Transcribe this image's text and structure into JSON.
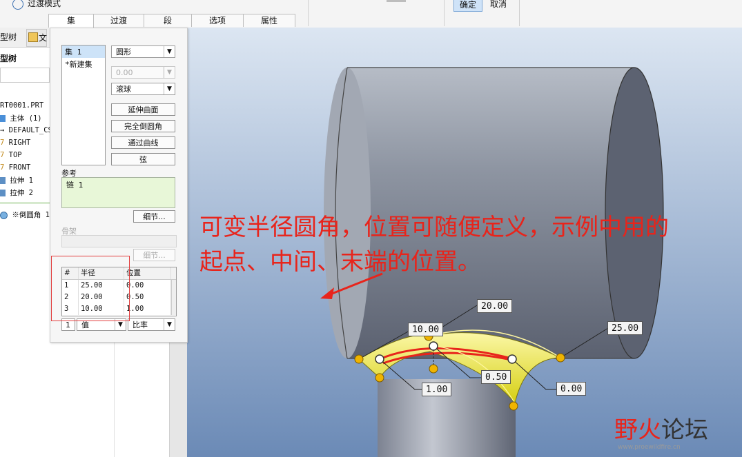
{
  "ribbon": {
    "transition_mode": "过渡模式",
    "tabs": [
      "集",
      "过渡",
      "段",
      "选项",
      "属性"
    ],
    "ok_label": "确定",
    "cancel_label": "取消"
  },
  "tree": {
    "tab_label": "型树",
    "tab2_label": "文",
    "title": "型树",
    "items": [
      "RT0001.PRT",
      "主体 (1)",
      "DEFAULT_CSY",
      "RIGHT",
      "TOP",
      "FRONT",
      "拉伸 1",
      "拉伸 2",
      "※倒圆角 1"
    ]
  },
  "dialog": {
    "set_list": [
      "集 1",
      "*新建集"
    ],
    "shape_value": "圆形",
    "disabled_value": "0.00",
    "method_value": "滚球",
    "buttons": [
      "延伸曲面",
      "完全倒圆角",
      "通过曲线",
      "弦"
    ],
    "ref_label": "参考",
    "ref_value": "链 1",
    "detail_label": "细节...",
    "skeleton_label": "骨架",
    "skeleton_detail_label": "细节...",
    "table": {
      "headers": [
        "#",
        "半径",
        "位置"
      ],
      "rows": [
        [
          "1",
          "25.00",
          "0.00"
        ],
        [
          "2",
          "20.00",
          "0.50"
        ],
        [
          "3",
          "10.00",
          "1.00"
        ]
      ]
    },
    "footer": {
      "index": "1",
      "type_value": "值",
      "ratio_value": "比率"
    }
  },
  "viewport": {
    "annotation_line1": "可变半径圆角，位置可随便定义，示例中用的",
    "annotation_line2": "起点、中间、末端的位置。",
    "tags": [
      "20.00",
      "10.00",
      "25.00",
      "0.50",
      "1.00",
      "0.00"
    ],
    "colors": {
      "background_top": "#d9e4f1",
      "background_bottom": "#6e8db9",
      "round": "#f2ec24",
      "annotation": "#e8241b"
    }
  },
  "logo": {
    "fire": "野火",
    "text": "论坛",
    "sub": "www.proewildfire.cn"
  }
}
